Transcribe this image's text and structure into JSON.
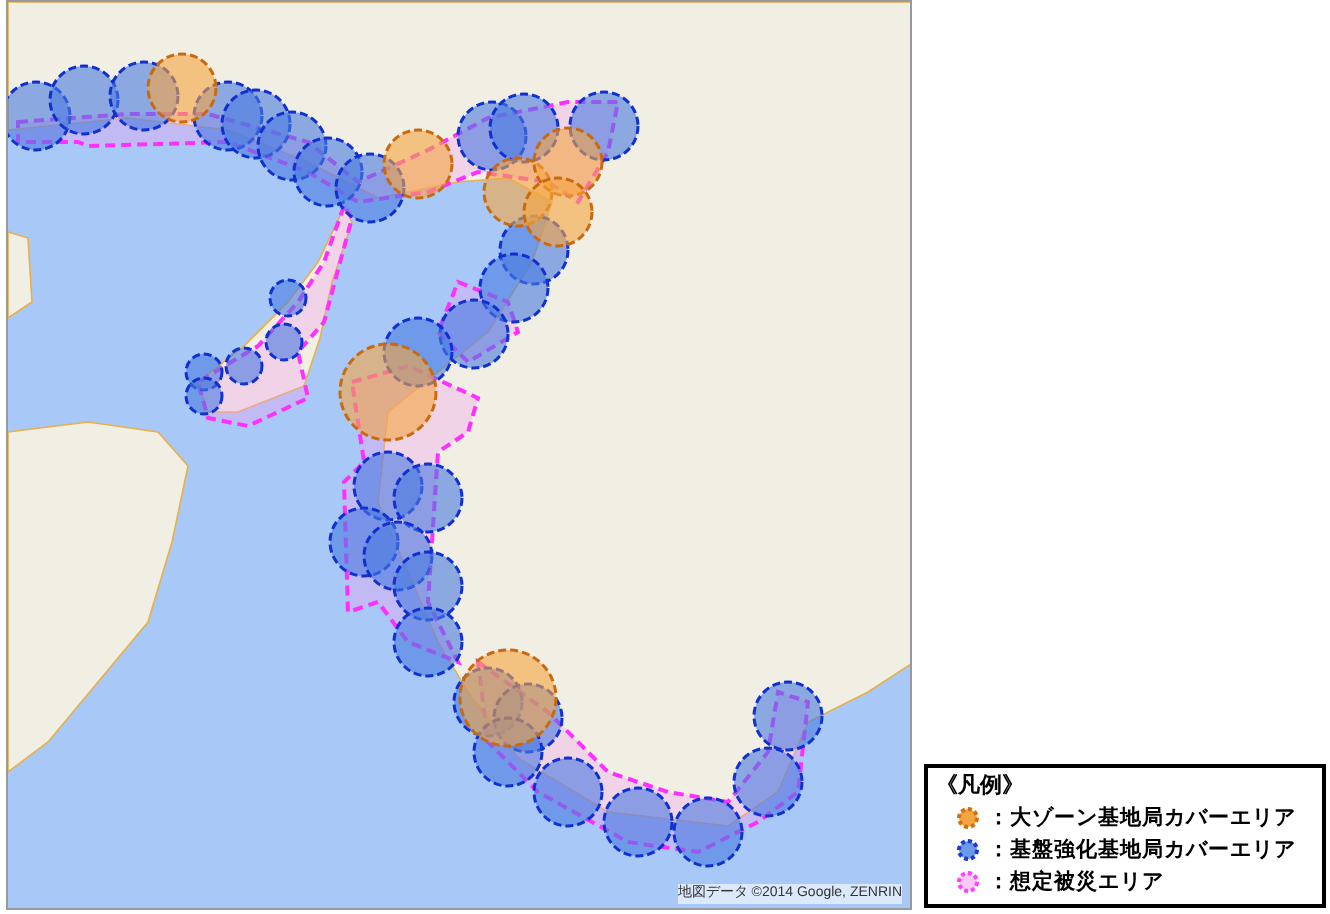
{
  "map": {
    "attribution": "地図データ ©2014 Google, ZENRIN"
  },
  "legend": {
    "title": "《凡例》",
    "items": [
      {
        "kind": "large-zone",
        "label": "：大ゾーン基地局カバーエリア"
      },
      {
        "kind": "reinforced",
        "label": "：基盤強化基地局カバーエリア"
      },
      {
        "kind": "disaster",
        "label": "：想定被災エリア"
      }
    ]
  }
}
